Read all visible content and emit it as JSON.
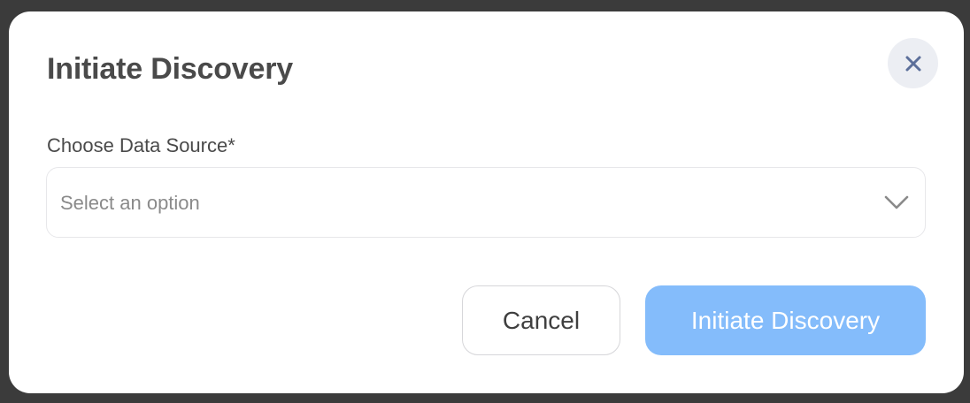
{
  "modal": {
    "title": "Initiate Discovery",
    "close_icon": "close-icon"
  },
  "form": {
    "data_source_label": "Choose Data Source*",
    "data_source_placeholder": "Select an option",
    "chevron_icon": "chevron-down-icon"
  },
  "actions": {
    "cancel_label": "Cancel",
    "submit_label": "Initiate Discovery"
  },
  "colors": {
    "backdrop": "#3b3b3b",
    "primary_disabled": "#84bcfb",
    "close_icon": "#5c6f9a"
  }
}
